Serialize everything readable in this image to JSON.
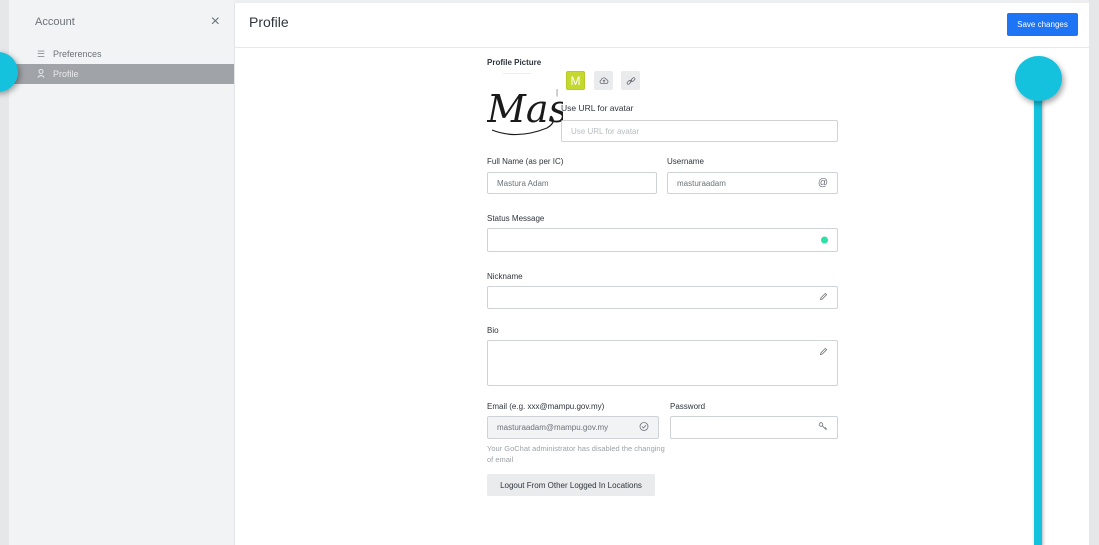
{
  "sidebar": {
    "title": "Account",
    "items": [
      {
        "label": "Preferences",
        "icon": "sliders-icon"
      },
      {
        "label": "Profile",
        "icon": "user-icon"
      }
    ]
  },
  "header": {
    "title": "Profile",
    "save_label": "Save changes"
  },
  "form": {
    "profile_picture_label": "Profile Picture",
    "avatar_letter": "M",
    "avatar_signature": "Mastura",
    "url_label": "Use URL for avatar",
    "url_placeholder": "Use URL for avatar",
    "full_name_label": "Full Name (as per IC)",
    "full_name_value": "Mastura Adam",
    "username_label": "Username",
    "username_value": "masturaadam",
    "username_icon": "@",
    "status_label": "Status Message",
    "status_value": "",
    "nickname_label": "Nickname",
    "nickname_value": "",
    "bio_label": "Bio",
    "bio_value": "",
    "email_label": "Email (e.g. xxx@mampu.gov.my)",
    "email_value": "masturaadam@mampu.gov.my",
    "email_hint": "Your GoChat administrator has disabled the changing of email",
    "password_label": "Password",
    "password_value": "",
    "logout_label": "Logout From Other Logged In Locations"
  },
  "colors": {
    "accent": "#1d74f5",
    "status_online": "#2de0a5",
    "avatar_bg": "#c4d82f",
    "annotation": "#14c2dd"
  }
}
